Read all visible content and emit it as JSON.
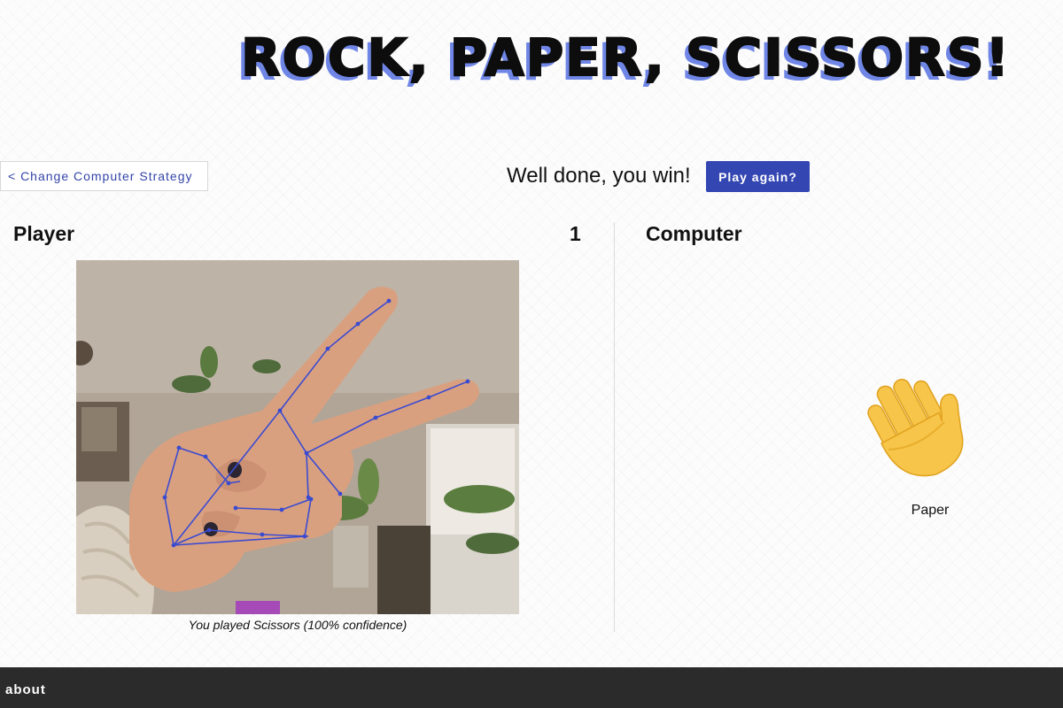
{
  "header": {
    "title": "ROCK, PAPER, SCISSORS!"
  },
  "controls": {
    "change_strategy_label": "< Change Computer Strategy",
    "result_message": "Well done, you win!",
    "play_again_label": "Play again?"
  },
  "player": {
    "heading": "Player",
    "score": "1",
    "caption": "You played Scissors (100% confidence)",
    "gesture_icon": "scissors-hand-photo"
  },
  "computer": {
    "heading": "Computer",
    "choice_label": "Paper",
    "choice_icon": "waving-hand-icon"
  },
  "footer": {
    "about_label": "about"
  },
  "colors": {
    "accent": "#3446b2",
    "title_shadow": "#6f86e6",
    "footer_bg": "#2b2b2b",
    "landmark_lines": "#3b4bd0"
  }
}
